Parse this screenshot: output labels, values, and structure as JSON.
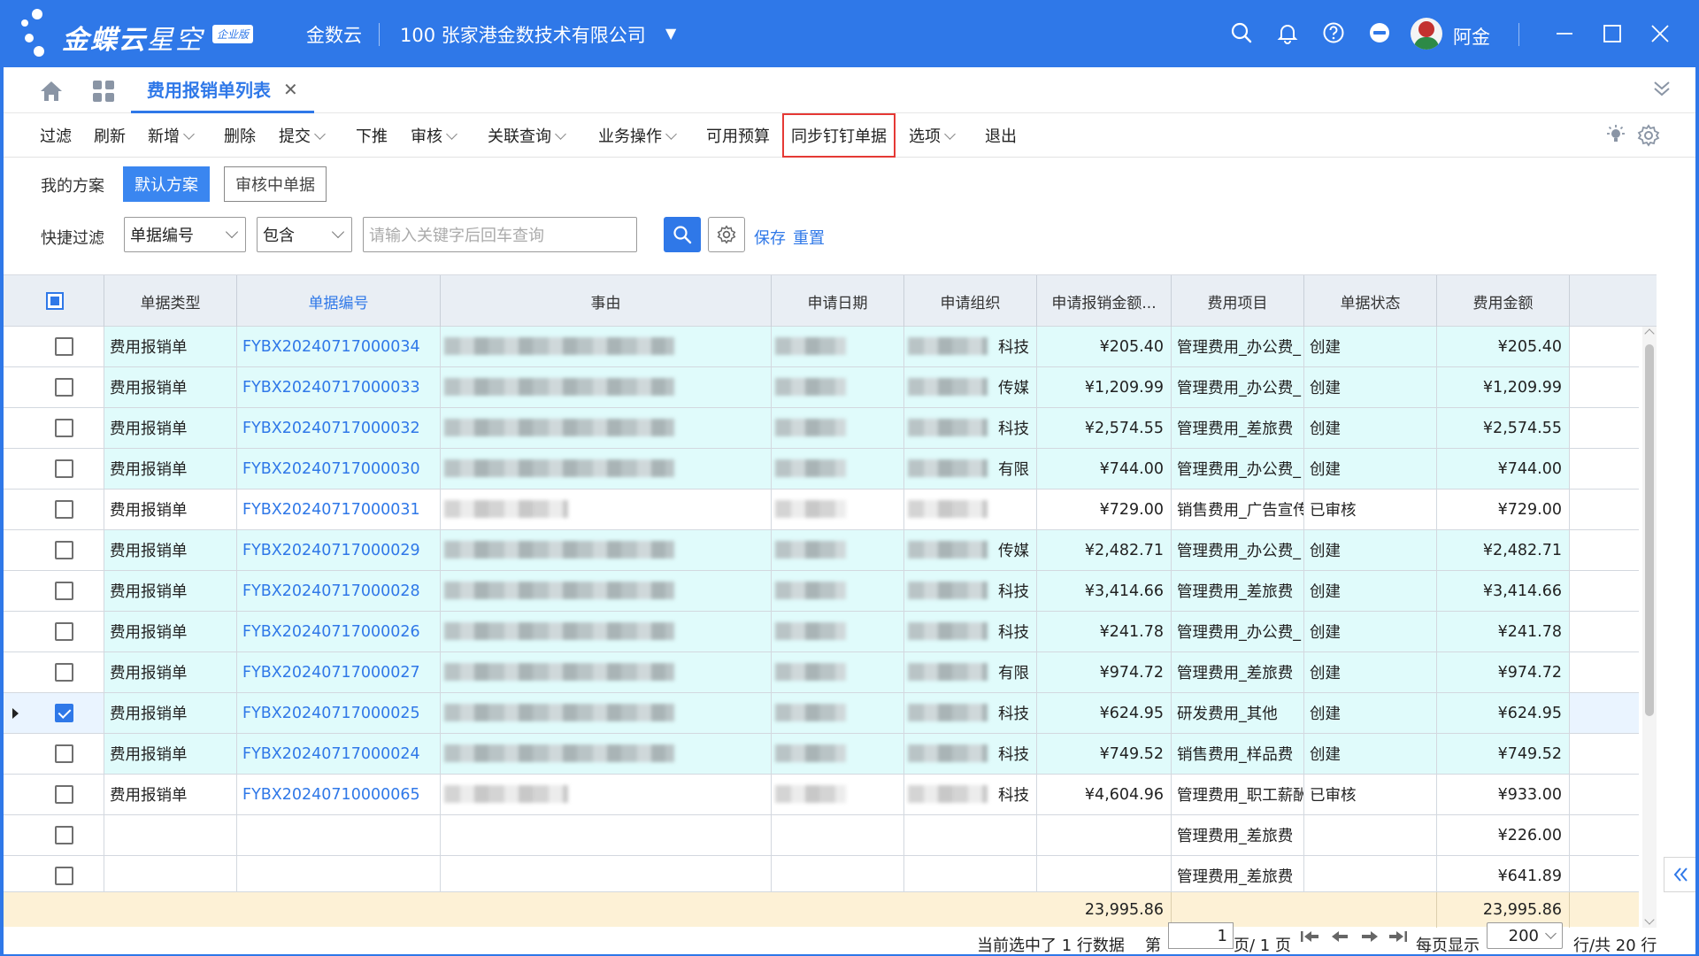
{
  "titlebar": {
    "logo_brand": "金蝶云",
    "logo_product": "星空",
    "logo_badge": "企业版",
    "app_name": "金数云",
    "org": "100  张家港金数技术有限公司",
    "user_name": "阿金"
  },
  "tabs": [
    {
      "label": "费用报销单列表",
      "active": true
    }
  ],
  "toolbar": {
    "items": [
      {
        "label": "过滤",
        "dropdown": false
      },
      {
        "label": "刷新",
        "dropdown": false
      },
      {
        "label": "新增",
        "dropdown": true
      },
      {
        "label": "删除",
        "dropdown": false
      },
      {
        "label": "提交",
        "dropdown": true
      },
      {
        "label": "下推",
        "dropdown": false
      },
      {
        "label": "审核",
        "dropdown": true
      },
      {
        "label": "关联查询",
        "dropdown": true
      },
      {
        "label": "业务操作",
        "dropdown": true
      },
      {
        "label": "可用预算",
        "dropdown": false
      },
      {
        "label": "同步钉钉单据",
        "dropdown": false,
        "highlighted": true
      },
      {
        "label": "选项",
        "dropdown": true
      },
      {
        "label": "退出",
        "dropdown": false
      }
    ]
  },
  "filter": {
    "scheme_label": "我的方案",
    "schemes": [
      {
        "label": "默认方案",
        "active": true
      },
      {
        "label": "审核中单据",
        "active": false
      }
    ],
    "quick_label": "快捷过滤",
    "field_select": "单据编号",
    "op_select": "包含",
    "keyword_placeholder": "请输入关键字后回车查询",
    "save_label": "保存",
    "reset_label": "重置"
  },
  "grid": {
    "columns": [
      "单据类型",
      "单据编号",
      "事由",
      "申请日期",
      "申请组织",
      "申请报销金额...",
      "费用项目",
      "单据状态",
      "费用金额"
    ],
    "rows": [
      {
        "type": "费用报销单",
        "no": "FYBX20240717000034",
        "org_tail": "科技",
        "amount": "¥205.40",
        "item": "管理费用_办公费_",
        "status": "创建",
        "fee": "¥205.40",
        "checked": false,
        "cyan": true
      },
      {
        "type": "费用报销单",
        "no": "FYBX20240717000033",
        "org_tail": "传媒",
        "amount": "¥1,209.99",
        "item": "管理费用_办公费_",
        "status": "创建",
        "fee": "¥1,209.99",
        "checked": false,
        "cyan": true
      },
      {
        "type": "费用报销单",
        "no": "FYBX20240717000032",
        "org_tail": "科技",
        "amount": "¥2,574.55",
        "item": "管理费用_差旅费",
        "status": "创建",
        "fee": "¥2,574.55",
        "checked": false,
        "cyan": true
      },
      {
        "type": "费用报销单",
        "no": "FYBX20240717000030",
        "org_tail": "有限",
        "amount": "¥744.00",
        "item": "管理费用_办公费_",
        "status": "创建",
        "fee": "¥744.00",
        "checked": false,
        "cyan": true
      },
      {
        "type": "费用报销单",
        "no": "FYBX20240717000031",
        "org_tail": "",
        "amount": "¥729.00",
        "item": "销售费用_广告宣传",
        "status": "已审核",
        "fee": "¥729.00",
        "checked": false,
        "cyan": false
      },
      {
        "type": "费用报销单",
        "no": "FYBX20240717000029",
        "org_tail": "传媒",
        "amount": "¥2,482.71",
        "item": "管理费用_办公费_",
        "status": "创建",
        "fee": "¥2,482.71",
        "checked": false,
        "cyan": true
      },
      {
        "type": "费用报销单",
        "no": "FYBX20240717000028",
        "org_tail": "科技",
        "amount": "¥3,414.66",
        "item": "管理费用_差旅费",
        "status": "创建",
        "fee": "¥3,414.66",
        "checked": false,
        "cyan": true
      },
      {
        "type": "费用报销单",
        "no": "FYBX20240717000026",
        "org_tail": "科技",
        "amount": "¥241.78",
        "item": "管理费用_办公费_",
        "status": "创建",
        "fee": "¥241.78",
        "checked": false,
        "cyan": true
      },
      {
        "type": "费用报销单",
        "no": "FYBX20240717000027",
        "org_tail": "有限",
        "amount": "¥974.72",
        "item": "管理费用_差旅费",
        "status": "创建",
        "fee": "¥974.72",
        "checked": false,
        "cyan": true
      },
      {
        "type": "费用报销单",
        "no": "FYBX20240717000025",
        "org_tail": "科技",
        "amount": "¥624.95",
        "item": "研发费用_其他",
        "status": "创建",
        "fee": "¥624.95",
        "checked": true,
        "cyan": true,
        "current": true
      },
      {
        "type": "费用报销单",
        "no": "FYBX20240717000024",
        "org_tail": "科技",
        "amount": "¥749.52",
        "item": "销售费用_样品费",
        "status": "创建",
        "fee": "¥749.52",
        "checked": false,
        "cyan": true
      },
      {
        "type": "费用报销单",
        "no": "FYBX20240710000065",
        "org_tail": "科技",
        "amount": "¥4,604.96",
        "item": "管理费用_职工薪酬",
        "status": "已审核",
        "fee": "¥933.00",
        "checked": false,
        "cyan": false
      },
      {
        "type": "",
        "no": "",
        "org_tail": "",
        "amount": "",
        "item": "管理费用_差旅费",
        "status": "",
        "fee": "¥226.00",
        "checked": false,
        "cyan": false
      },
      {
        "type": "",
        "no": "",
        "org_tail": "",
        "amount": "",
        "item": "管理费用_差旅费",
        "status": "",
        "fee": "¥641.89",
        "checked": false,
        "cyan": false
      }
    ],
    "total_amount": "23,995.86",
    "total_fee": "23,995.86"
  },
  "pager": {
    "selected_text": "当前选中了 1 行数据",
    "page_prefix": "第",
    "page_value": "1",
    "page_suffix": "页/ 1 页",
    "per_page_label": "每页显示",
    "per_page_value": "200",
    "total_text": "行/共 20 行"
  }
}
